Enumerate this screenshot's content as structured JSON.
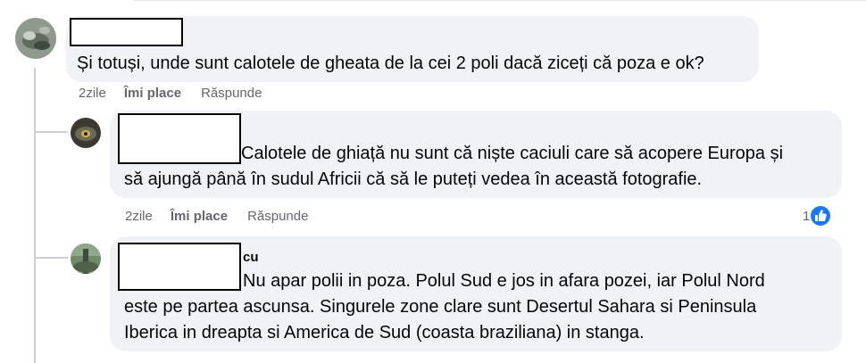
{
  "comments": [
    {
      "text": "Și totuși, unde sunt calotele de gheata de la cei 2 poli dacă ziceți că poza e ok?",
      "time": "2zile",
      "like_label": "Îmi place",
      "reply_label": "Răspunde"
    },
    {
      "text_lines": [
        "Calotele de ghiață nu sunt că niște caciuli care să acopere Europa și",
        "să ajungă până în sudul Africii că să le puteți vedea în această fotografie."
      ],
      "time": "2zile",
      "like_label": "Îmi place",
      "reply_label": "Răspunde",
      "reaction_count": "1",
      "reaction_icon": "like-thumb-icon",
      "reaction_color": "#1877f2"
    },
    {
      "name_fragment": "cu",
      "text_lines": [
        "Nu apar polii in poza. Polul Sud e jos in afara pozei, iar Polul Nord",
        "este pe partea ascunsa. Singurele zone clare sunt Desertul Sahara si Peninsula",
        "Iberica in dreapta si America de Sud (coasta braziliana) in stanga."
      ]
    }
  ],
  "colors": {
    "bubble": "#f0f2f5",
    "meta_text": "#65676b",
    "like_blue": "#1877f2",
    "thread_line": "#ccd0d5"
  }
}
